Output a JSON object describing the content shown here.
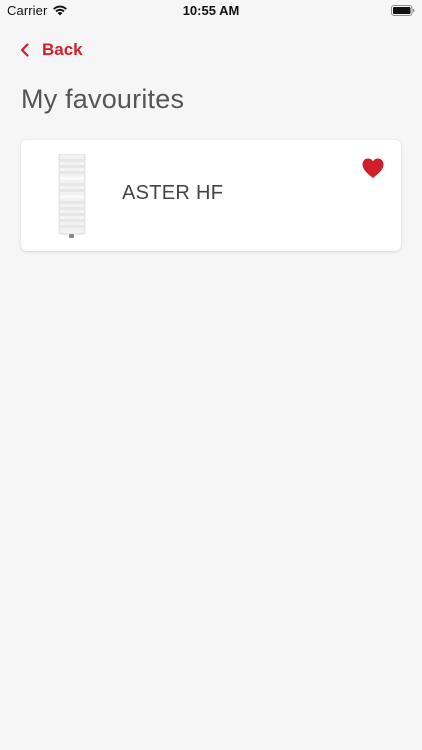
{
  "status_bar": {
    "carrier": "Carrier",
    "time": "10:55 AM",
    "icons": [
      "wifi-icon",
      "battery-icon"
    ]
  },
  "nav": {
    "back_label": "Back",
    "back_icon": "chevron-left-icon"
  },
  "page": {
    "title": "My favourites"
  },
  "favourites": [
    {
      "name": "ASTER HF",
      "image": "towel-radiator-image",
      "favourite_icon": "heart-icon"
    }
  ],
  "colors": {
    "accent": "#d0202a",
    "background": "#f6f6f6",
    "card": "#ffffff",
    "title_text": "#555555",
    "body_text": "#444444"
  }
}
